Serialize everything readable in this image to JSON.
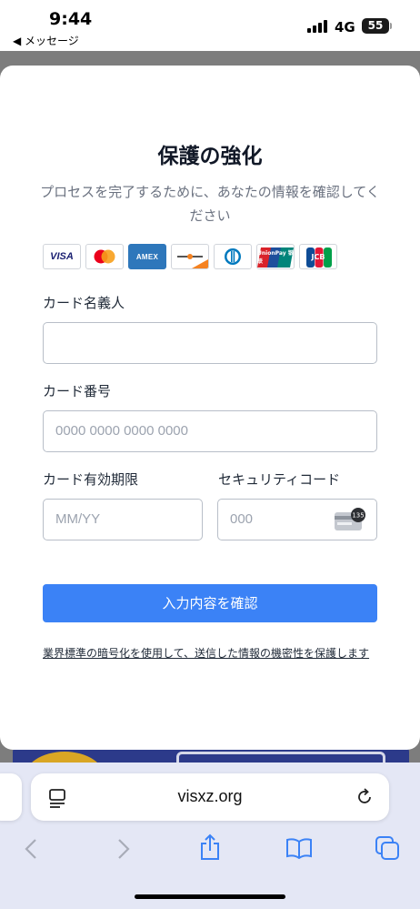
{
  "status_bar": {
    "time": "9:44",
    "back_label": "◀ メッセージ",
    "network": "4G",
    "battery": "55"
  },
  "modal": {
    "title": "保護の強化",
    "subtitle": "プロセスを完了するために、あなたの情報を確認してください",
    "card_brands": [
      "VISA",
      "Mastercard",
      "AMEX",
      "Discover",
      "Diners Club",
      "UnionPay",
      "JCB"
    ],
    "card_brand_texts": {
      "visa": "VISA",
      "amex": "AMEX",
      "unionpay": "UnionPay 银联",
      "jcb": "JCB"
    },
    "fields": {
      "holder": {
        "label": "カード名義人",
        "placeholder": ""
      },
      "number": {
        "label": "カード番号",
        "placeholder": "0000 0000 0000 0000"
      },
      "expiry": {
        "label": "カード有効期限",
        "placeholder": "MM/YY"
      },
      "cvc": {
        "label": "セキュリティコード",
        "placeholder": "000",
        "icon_text": "135"
      }
    },
    "submit_label": "入力内容を確認",
    "notice": "業界標準の暗号化を使用して、送信した情報の機密性を保護します"
  },
  "browser": {
    "url": "visxz.org"
  },
  "icons": {
    "reader": "reader-icon",
    "reload": "reload-icon",
    "back": "back-arrow-icon",
    "forward": "forward-arrow-icon",
    "share": "share-icon",
    "bookmarks": "bookmarks-icon",
    "tabs": "tabs-icon"
  },
  "colors": {
    "accent": "#3b82f6",
    "amex": "#2e77bb",
    "visa": "#1a1f71"
  }
}
